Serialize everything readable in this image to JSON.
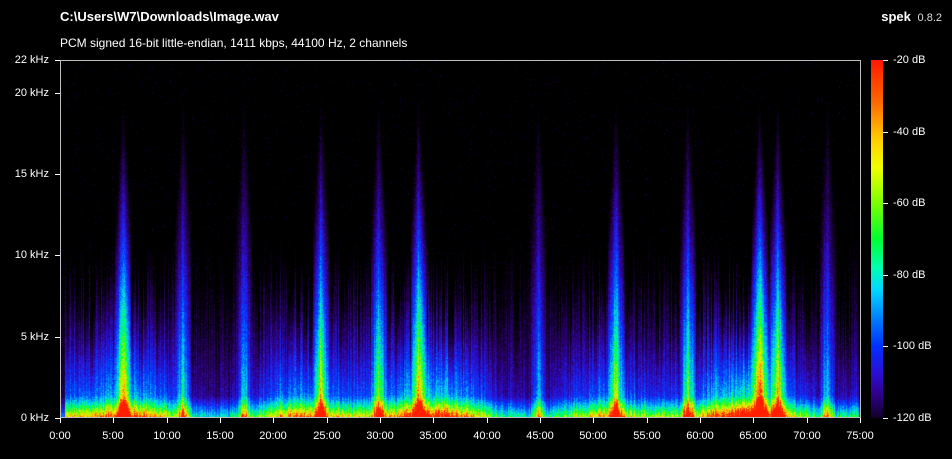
{
  "header": {
    "file_path": "C:\\Users\\W7\\Downloads\\Image.wav",
    "file_info": "PCM signed 16-bit little-endian, 1411 kbps, 44100 Hz, 2 channels"
  },
  "app": {
    "name": "spek",
    "version": "0.8.2"
  },
  "y_axis": {
    "labels": [
      "22 kHz",
      "20 kHz",
      "15 kHz",
      "10 kHz",
      "5 kHz",
      "0 kHz"
    ],
    "values_khz": [
      22,
      20,
      15,
      10,
      5,
      0
    ]
  },
  "x_axis": {
    "labels": [
      "0:00",
      "5:00",
      "10:00",
      "15:00",
      "20:00",
      "25:00",
      "30:00",
      "35:00",
      "40:00",
      "45:00",
      "50:00",
      "55:00",
      "60:00",
      "65:00",
      "70:00",
      "75:00"
    ],
    "values_min": [
      0,
      5,
      10,
      15,
      20,
      25,
      30,
      35,
      40,
      45,
      50,
      55,
      60,
      65,
      70,
      75
    ]
  },
  "db_scale": {
    "labels": [
      "-20 dB",
      "-40 dB",
      "-60 dB",
      "-80 dB",
      "-100 dB",
      "-120 dB"
    ],
    "values_db": [
      -20,
      -40,
      -60,
      -80,
      -100,
      -120
    ]
  },
  "colors": {
    "background": "#000000",
    "text": "#ffffff",
    "frame": "#bfbfbf"
  }
}
